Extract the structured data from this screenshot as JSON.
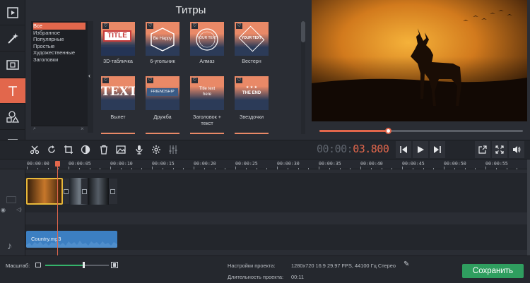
{
  "panel": {
    "title": "Титры",
    "filters": [
      "Все",
      "Избранное",
      "Популярные",
      "Простые",
      "Художественные",
      "Заголовки"
    ],
    "tiles": [
      {
        "label": "3D-табличка",
        "text": "TITLE"
      },
      {
        "label": "6-угольник",
        "text": "Be Happy"
      },
      {
        "label": "Алмаз",
        "text": "YOUR TEXT"
      },
      {
        "label": "Вестерн",
        "text": "YOUR TEXT"
      },
      {
        "label": "Вылет",
        "text": "TEXT"
      },
      {
        "label": "Дружба",
        "text": "FRIENDSHIP"
      },
      {
        "label": "Заголовок +\nтекст",
        "text": "Title text here"
      },
      {
        "label": "Звездочки",
        "text": "THE END"
      }
    ]
  },
  "player": {
    "timecode_dim": "00:00:",
    "timecode_hot": "03.800",
    "progress": 0.34
  },
  "timeline": {
    "ticks": [
      "00:00:00",
      "00:00:05",
      "00:00:10",
      "00:00:15",
      "00:00:20",
      "00:00:25",
      "00:00:30",
      "00:00:35",
      "00:00:40",
      "00:00:45",
      "00:00:50",
      "00:00:55"
    ],
    "audio_clip": "Country.mp3"
  },
  "status": {
    "scale_label": "Масштаб:",
    "scale_value": 0.6,
    "settings_label": "Настройки проекта:",
    "settings_value": "1280x720 16:9 29.97 FPS, 44100 Гц Стерео",
    "duration_label": "Длительность проекта:",
    "duration_value": "00:11",
    "save_label": "Сохранить"
  },
  "colors": {
    "accent": "#e2674c",
    "save": "#2f9e5f",
    "audio": "#3c7fc2"
  },
  "icons": [
    "film-icon",
    "magic-wand-icon",
    "clip-icon",
    "title-text-icon",
    "shapes-icon",
    "list-icon",
    "scissors-icon",
    "redo-icon",
    "crop-icon",
    "color-adjust-icon",
    "trash-icon",
    "image-icon",
    "microphone-icon",
    "gear-icon",
    "equalizer-icon",
    "prev-icon",
    "play-icon",
    "next-icon",
    "export-icon",
    "fullscreen-icon",
    "volume-icon"
  ]
}
